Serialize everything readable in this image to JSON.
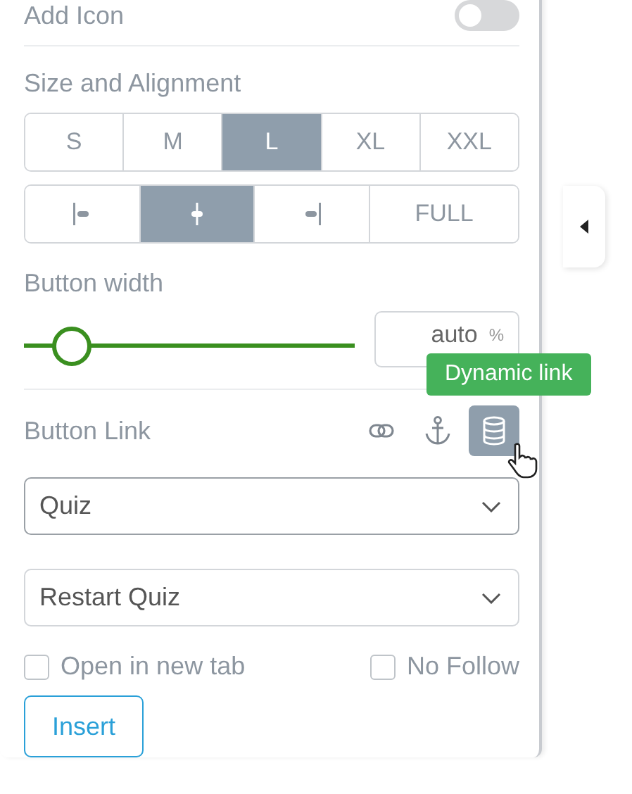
{
  "add_icon": {
    "label": "Add Icon",
    "on": false
  },
  "size_alignment": {
    "title": "Size and Alignment",
    "sizes": [
      {
        "label": "S",
        "selected": false
      },
      {
        "label": "M",
        "selected": false
      },
      {
        "label": "L",
        "selected": true
      },
      {
        "label": "XL",
        "selected": false
      },
      {
        "label": "XXL",
        "selected": false
      }
    ],
    "alignments": [
      {
        "kind": "left",
        "selected": false
      },
      {
        "kind": "center",
        "selected": true
      },
      {
        "kind": "right",
        "selected": false
      },
      {
        "kind": "full",
        "label": "FULL",
        "selected": false
      }
    ]
  },
  "button_width": {
    "title": "Button width",
    "level": 0.14,
    "value": "auto",
    "unit": "%"
  },
  "button_link": {
    "title": "Button Link",
    "tooltip": "Dynamic link",
    "link_types": [
      {
        "kind": "link",
        "selected": false
      },
      {
        "kind": "anchor",
        "selected": false
      },
      {
        "kind": "database",
        "selected": true
      }
    ],
    "selects": [
      {
        "value": "Quiz"
      },
      {
        "value": "Restart Quiz"
      }
    ],
    "checkboxes": [
      {
        "label": "Open in new tab",
        "checked": false
      },
      {
        "label": "No Follow",
        "checked": false
      }
    ],
    "insert": "Insert"
  }
}
